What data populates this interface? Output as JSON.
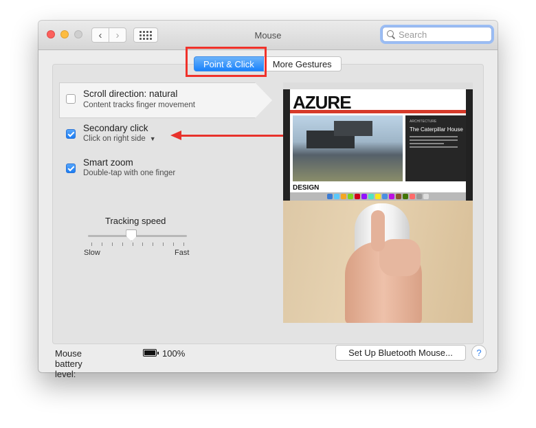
{
  "window": {
    "title": "Mouse",
    "search_placeholder": "Search"
  },
  "tabs": [
    {
      "label": "Point & Click",
      "active": true
    },
    {
      "label": "More Gestures",
      "active": false
    }
  ],
  "options": [
    {
      "title": "Scroll direction: natural",
      "subtitle": "Content tracks finger movement",
      "checked": false
    },
    {
      "title": "Secondary click",
      "subtitle": "Click on right side",
      "checked": true
    },
    {
      "title": "Smart zoom",
      "subtitle": "Double-tap with one finger",
      "checked": true
    }
  ],
  "tracking": {
    "label": "Tracking speed",
    "min_label": "Slow",
    "max_label": "Fast",
    "value_fraction": 0.44
  },
  "preview": {
    "site_title": "AZURE",
    "article_kicker": "ARCHITECTURE",
    "article_title": "The Caterpillar House",
    "section_label": "DESIGN"
  },
  "footer": {
    "battery_label": "Mouse battery level:",
    "battery_value": "100%",
    "bluetooth_button": "Set Up Bluetooth Mouse...",
    "help_button": "?"
  },
  "colors": {
    "accent": "#1a82fb",
    "annotation_red": "#e8322c"
  }
}
